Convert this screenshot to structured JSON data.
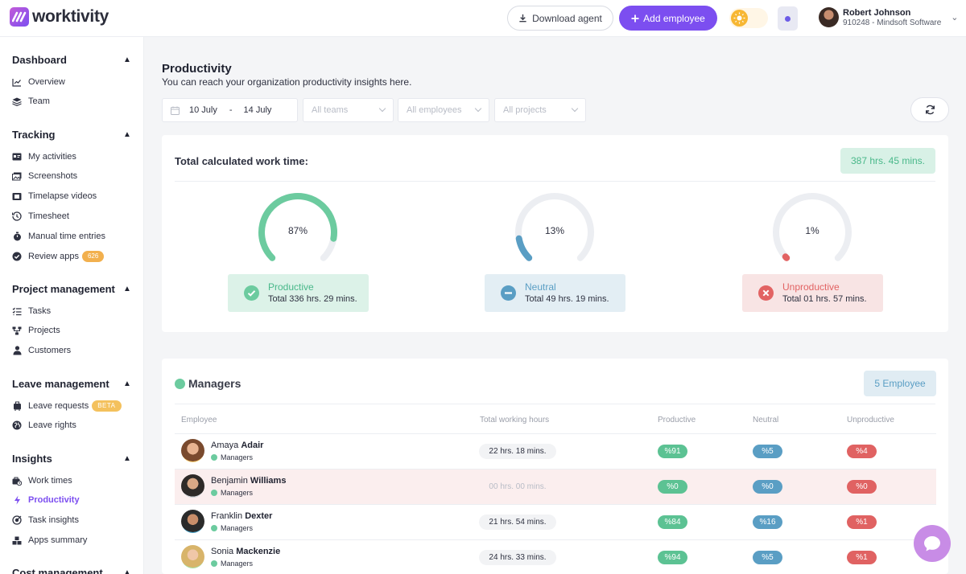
{
  "app": {
    "name": "worktivity"
  },
  "header": {
    "download_label": "Download agent",
    "add_label": "Add employee",
    "user_name": "Robert Johnson",
    "user_sub": "910248 - Mindsoft Software"
  },
  "sidebar": {
    "dashboard": {
      "title": "Dashboard",
      "items": [
        {
          "label": "Overview"
        },
        {
          "label": "Team"
        }
      ]
    },
    "tracking": {
      "title": "Tracking",
      "items": [
        {
          "label": "My activities"
        },
        {
          "label": "Screenshots"
        },
        {
          "label": "Timelapse videos"
        },
        {
          "label": "Timesheet"
        },
        {
          "label": "Manual time entries"
        },
        {
          "label": "Review apps",
          "badge": "626"
        }
      ]
    },
    "project": {
      "title": "Project management",
      "items": [
        {
          "label": "Tasks"
        },
        {
          "label": "Projects"
        },
        {
          "label": "Customers"
        }
      ]
    },
    "leave": {
      "title": "Leave management",
      "items": [
        {
          "label": "Leave requests",
          "badge": "BETA"
        },
        {
          "label": "Leave rights"
        }
      ]
    },
    "insights": {
      "title": "Insights",
      "items": [
        {
          "label": "Work times"
        },
        {
          "label": "Productivity"
        },
        {
          "label": "Task insights"
        },
        {
          "label": "Apps summary"
        }
      ]
    },
    "cost": {
      "title": "Cost management"
    }
  },
  "page": {
    "title": "Productivity",
    "subtitle": "You can reach your organization productivity insights here."
  },
  "filters": {
    "date_from": "10 July",
    "date_sep": "-",
    "date_to": "14 July",
    "teams_placeholder": "All teams",
    "employees_placeholder": "All employees",
    "projects_placeholder": "All projects"
  },
  "summary": {
    "label": "Total calculated work time:",
    "total": "387 hrs. 45 mins.",
    "productive": {
      "percent": 87,
      "pct_label": "87%",
      "label": "Productive",
      "total": "Total 336 hrs. 29 mins.",
      "color": "#6ccb9f"
    },
    "neutral": {
      "percent": 13,
      "pct_label": "13%",
      "label": "Neutral",
      "total": "Total 49 hrs. 19 mins.",
      "color": "#5a9ec4"
    },
    "unproductive": {
      "percent": 1,
      "pct_label": "1%",
      "label": "Unproductive",
      "total": "Total 01 hrs. 57 mins.",
      "color": "#e26363"
    }
  },
  "managers": {
    "title": "Managers",
    "count_label": "5 Employee",
    "columns": [
      "Employee",
      "Total working hours",
      "Productive",
      "Neutral",
      "Unproductive"
    ],
    "rows": [
      {
        "first": "Amaya",
        "last": "Adair",
        "role": "Managers",
        "hours": "22 hrs. 18 mins.",
        "productive": "%91",
        "neutral": "%5",
        "unproductive": "%4"
      },
      {
        "first": "Benjamin",
        "last": "Williams",
        "role": "Managers",
        "hours": "00 hrs. 00 mins.",
        "productive": "%0",
        "neutral": "%0",
        "unproductive": "%0"
      },
      {
        "first": "Franklin",
        "last": "Dexter",
        "role": "Managers",
        "hours": "21 hrs. 54 mins.",
        "productive": "%84",
        "neutral": "%16",
        "unproductive": "%1"
      },
      {
        "first": "Sonia",
        "last": "Mackenzie",
        "role": "Managers",
        "hours": "24 hrs. 33 mins.",
        "productive": "%94",
        "neutral": "%5",
        "unproductive": "%1"
      }
    ]
  }
}
